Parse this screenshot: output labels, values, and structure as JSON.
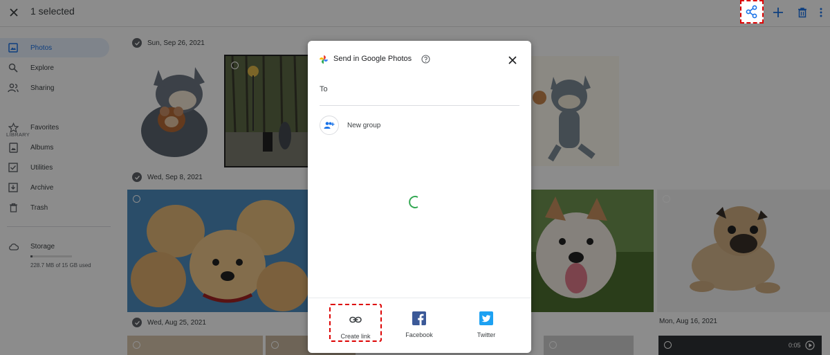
{
  "topbar": {
    "selected_label": "1 selected",
    "icons": [
      "close-icon",
      "share-icon",
      "add-icon",
      "trash-icon",
      "more-vert-icon"
    ]
  },
  "sidebar": {
    "items": [
      {
        "label": "Photos",
        "icon": "photo-icon",
        "active": true
      },
      {
        "label": "Explore",
        "icon": "search-icon"
      },
      {
        "label": "Sharing",
        "icon": "people-icon"
      },
      {
        "label": "Favorites",
        "icon": "star-icon"
      },
      {
        "label": "Albums",
        "icon": "album-icon"
      },
      {
        "label": "Utilities",
        "icon": "checklist-icon"
      },
      {
        "label": "Archive",
        "icon": "archive-icon"
      },
      {
        "label": "Trash",
        "icon": "trash-icon"
      }
    ],
    "library_header": "LIBRARY",
    "storage": {
      "label": "Storage",
      "usage": "228.7 MB of 15 GB used",
      "used_fraction": 0.015
    }
  },
  "content": {
    "dates": [
      "Sun, Sep 26, 2021",
      "Wed, Sep 8, 2021",
      "Wed, Aug 25, 2021",
      "Mon, Aug 16, 2021"
    ],
    "video_duration": "0:05"
  },
  "dialog": {
    "title": "Send in Google Photos",
    "to_label": "To",
    "new_group_label": "New group",
    "share_options": [
      {
        "label": "Create link",
        "icon": "link-icon",
        "highlighted": true
      },
      {
        "label": "Facebook",
        "icon": "facebook-icon"
      },
      {
        "label": "Twitter",
        "icon": "twitter-icon"
      }
    ]
  },
  "colors": {
    "accent": "#1a73e8",
    "highlight": "#dd0000",
    "spinner": "#34a853",
    "facebook": "#3b5998",
    "twitter": "#1da1f2"
  }
}
